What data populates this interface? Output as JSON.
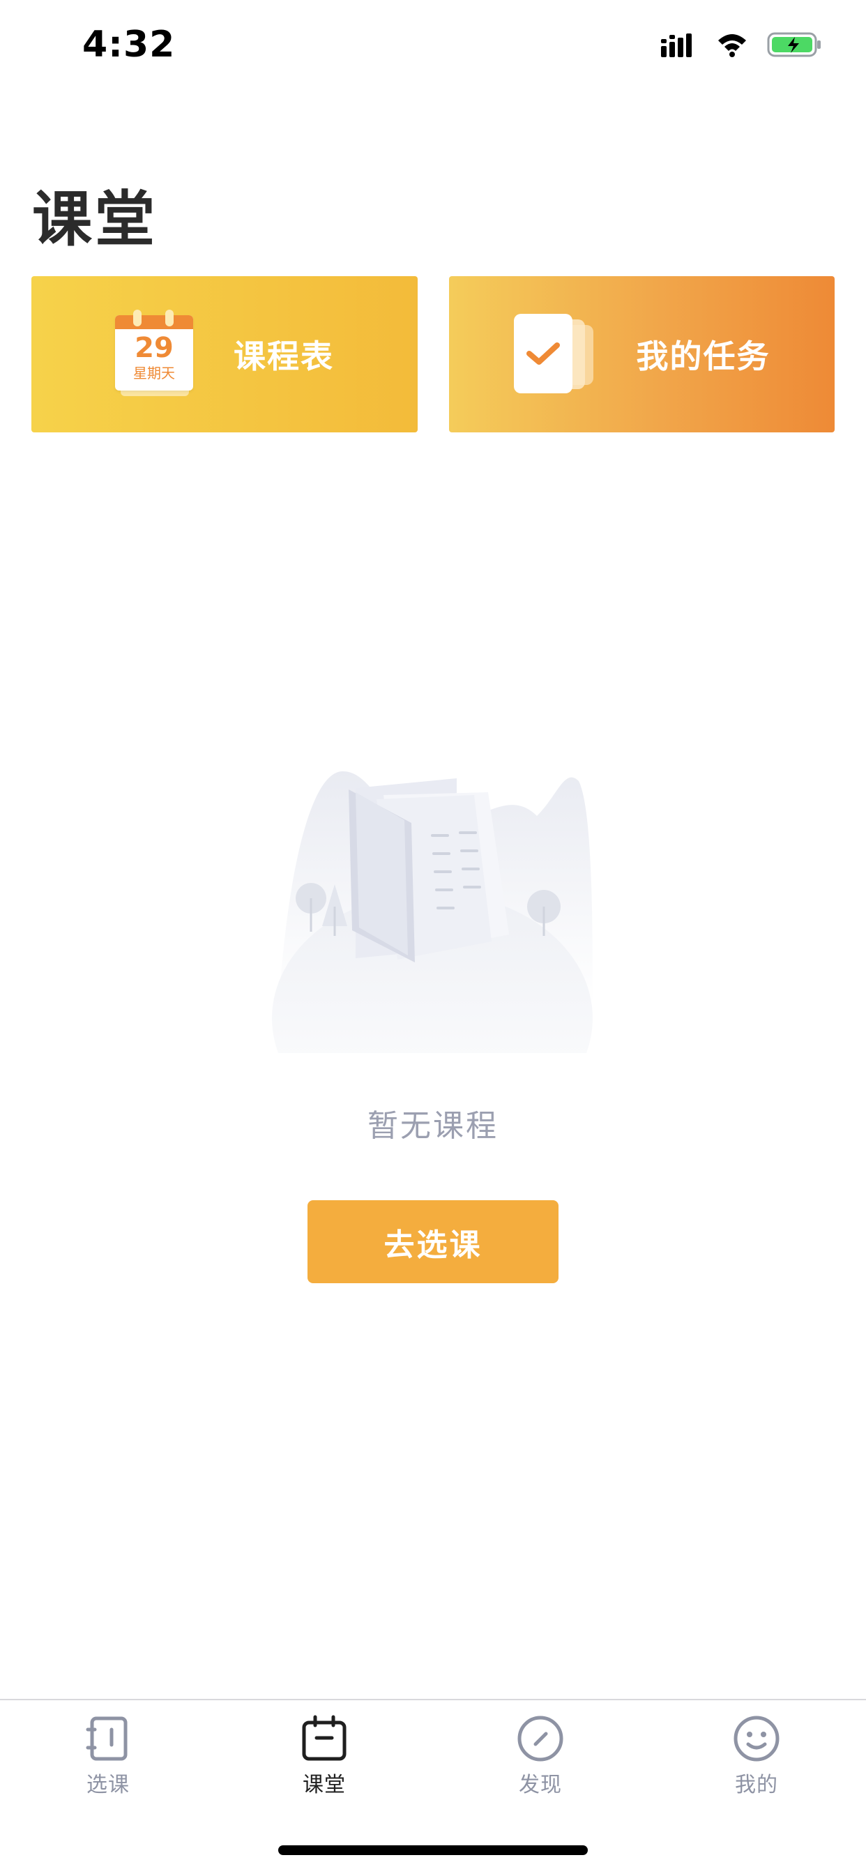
{
  "status_bar": {
    "time": "4:32"
  },
  "page": {
    "title": "课堂"
  },
  "cards": {
    "schedule": {
      "label": "课程表",
      "calendar_day": "29",
      "calendar_weekday": "星期天"
    },
    "tasks": {
      "label": "我的任务"
    }
  },
  "empty_state": {
    "message": "暂无课程",
    "button_label": "去选课"
  },
  "tabs": [
    {
      "label": "选课",
      "icon": "notebook-icon",
      "active": false
    },
    {
      "label": "课堂",
      "icon": "calendar-icon",
      "active": true
    },
    {
      "label": "发现",
      "icon": "compass-icon",
      "active": false
    },
    {
      "label": "我的",
      "icon": "smiley-icon",
      "active": false
    }
  ],
  "colors": {
    "accent": "#f4ad3e",
    "schedule_card_start": "#f6d24a",
    "tasks_card_end": "#ee8a36",
    "muted_text": "#9b9fb0",
    "active_tab": "#1f1f1f"
  }
}
